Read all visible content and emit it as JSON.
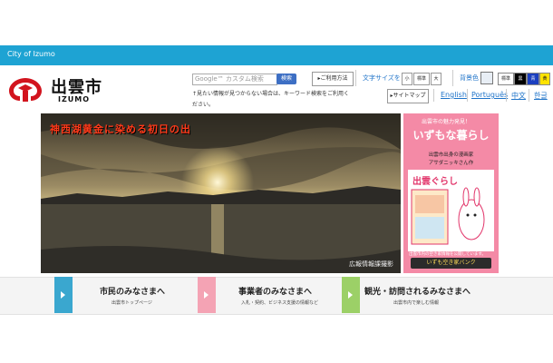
{
  "topbar": {
    "city": "City of Izumo"
  },
  "logo": {
    "name_jp": "出雲市",
    "name_en": "IZUMO"
  },
  "search": {
    "placeholder": "Google™ カスタム検索",
    "button": "検索",
    "note": "↑見たい情報が見つからない場合は、キーワード検索をご利用ください。"
  },
  "utility": {
    "howto": "▸ご利用方法",
    "sitemap": "▸サイトマップ",
    "fontsize_label": "文字サイズを",
    "fontsize": [
      "小",
      "標準",
      "大"
    ],
    "bgcolor_label": "背景色",
    "bgcolor": [
      "標準",
      "黒",
      "青",
      "黄"
    ]
  },
  "languages": [
    "English",
    "Português",
    "中文",
    "한글"
  ],
  "hero": {
    "title": "神西湖黄金に染める初日の出",
    "credit": "広報情報課撮影"
  },
  "ad": {
    "top": "出雲市の魅力発見！",
    "title": "いずもな暮らし",
    "sub1": "出雲市出身の漫画家",
    "sub2": "アサダニッキさん作",
    "brand": "出雲ぐらし",
    "note": "出雲市内の空き家情報を公開しています。",
    "button": "いずも空き家バンク"
  },
  "nav": [
    {
      "title": "市民のみなさまへ",
      "sub": "出雲市トップページ",
      "color": "#3aa7cf"
    },
    {
      "title": "事業者のみなさまへ",
      "sub": "入札・契約、ビジネス支援の情報など",
      "color": "#f4a3b4"
    },
    {
      "title": "観光・訪問されるみなさまへ",
      "sub": "出雲市内で楽しむ情報",
      "color": "#9cd067"
    }
  ]
}
